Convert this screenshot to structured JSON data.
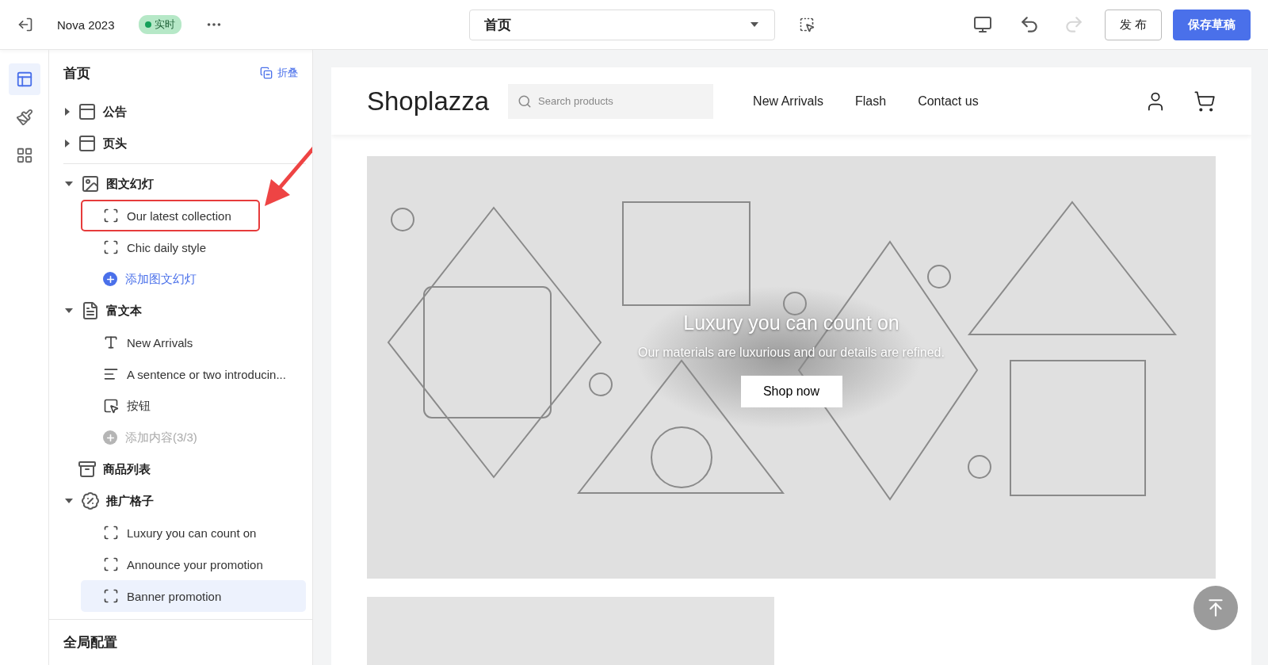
{
  "top_bar": {
    "theme_name": "Nova 2023",
    "status_badge": "实时",
    "page_select": {
      "value": "首页"
    },
    "undo": {
      "disabled": false
    },
    "redo": {
      "disabled": true
    },
    "buttons": [
      {
        "label": "发 布",
        "kind": "secondary"
      },
      {
        "label": "保存草稿",
        "kind": "primary"
      }
    ]
  },
  "rail": [
    {
      "kind": "sections",
      "selected": true
    },
    {
      "kind": "theme",
      "selected": false
    },
    {
      "kind": "apps",
      "selected": false
    }
  ],
  "sidebar": {
    "title": "首页",
    "collapse_link": "折叠",
    "sections": [
      {
        "label": "公告",
        "kind": "announcement",
        "expanded": false,
        "selected": false
      },
      {
        "label": "页头",
        "kind": "header",
        "expanded": false,
        "selected": false
      },
      {
        "kind": "divider"
      },
      {
        "label": "图文幻灯",
        "kind": "slideshow",
        "expanded": true,
        "selected": false,
        "children": [
          {
            "label": "Our latest collection",
            "kind": "block",
            "selected": false,
            "annotated": true
          },
          {
            "label": "Chic daily style",
            "kind": "block",
            "selected": false
          },
          {
            "label": "添加图文幻灯",
            "kind": "add",
            "disabled": false
          }
        ]
      },
      {
        "label": "富文本",
        "kind": "rich_text",
        "expanded": true,
        "selected": false,
        "children": [
          {
            "label": "New Arrivals",
            "kind": "text",
            "selected": false
          },
          {
            "label": "A sentence or two introducin...",
            "kind": "paragraph",
            "selected": false
          },
          {
            "label": "按钮",
            "kind": "button",
            "selected": false
          },
          {
            "label": "添加内容(3/3)",
            "kind": "add",
            "disabled": true
          }
        ]
      },
      {
        "label": "商品列表",
        "kind": "product_list",
        "selected": false
      },
      {
        "label": "推广格子",
        "kind": "promo",
        "expanded": true,
        "selected": false,
        "children": [
          {
            "label": "Luxury you can count on",
            "kind": "block",
            "selected": false
          },
          {
            "label": "Announce your promotion",
            "kind": "block",
            "selected": false
          },
          {
            "label": "Banner promotion",
            "kind": "block",
            "selected": true
          }
        ]
      }
    ],
    "footer": "全局配置"
  },
  "preview": {
    "store": {
      "logo": "Shoplazza",
      "search_placeholder": "Search products",
      "nav": [
        "New Arrivals",
        "Flash",
        "Contact us"
      ]
    },
    "hero": {
      "kind": "picture",
      "heading": "Luxury you can count on",
      "subheading": "Our materials are luxurious and our details are refined.",
      "button": "Shop now"
    }
  }
}
